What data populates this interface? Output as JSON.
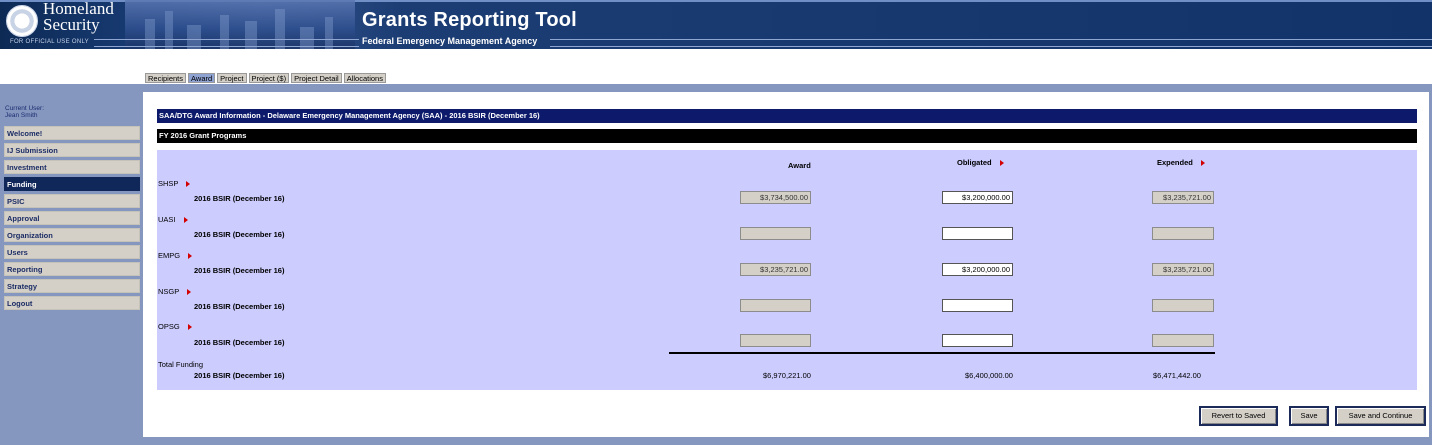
{
  "header": {
    "logo_text_line1": "Homeland",
    "logo_text_line2": "Security",
    "official_use": "FOR OFFICIAL USE ONLY",
    "title": "Grants Reporting Tool",
    "subtitle": "Federal Emergency Management Agency"
  },
  "tabs": [
    "Recipients",
    "Award",
    "Project",
    "Project ($)",
    "Project Detail",
    "Allocations"
  ],
  "active_tab": "Award",
  "user": {
    "label": "Current User:",
    "name": "Jean Smith"
  },
  "nav": [
    "Welcome!",
    "IJ Submission",
    "Investment",
    "Funding",
    "PSIC",
    "Approval",
    "Organization",
    "Users",
    "Reporting",
    "Strategy",
    "Logout"
  ],
  "active_nav": "Funding",
  "main": {
    "header_bar": "SAA/DTG Award Information - Delaware Emergency Management Agency (SAA) - 2016 BSIR (December 16)",
    "section_bar": "FY 2016 Grant Programs",
    "columns": {
      "award": "Award",
      "obligated": "Obligated",
      "expended": "Expended"
    },
    "programs": [
      {
        "name": "SHSP",
        "row_label": "2016 BSIR (December 16)",
        "award": "$3,734,500.00",
        "obligated": "$3,200,000.00",
        "expended": "$3,235,721.00"
      },
      {
        "name": "UASI",
        "row_label": "2016 BSIR (December 16)",
        "award": "",
        "obligated": "",
        "expended": ""
      },
      {
        "name": "EMPG",
        "row_label": "2016 BSIR (December 16)",
        "award": "$3,235,721.00",
        "obligated": "$3,200,000.00",
        "expended": "$3,235,721.00"
      },
      {
        "name": "NSGP",
        "row_label": "2016 BSIR (December 16)",
        "award": "",
        "obligated": "",
        "expended": ""
      },
      {
        "name": "OPSG",
        "row_label": "2016 BSIR (December 16)",
        "award": "",
        "obligated": "",
        "expended": ""
      }
    ],
    "total": {
      "label": "Total Funding",
      "row_label": "2016 BSIR (December 16)",
      "award": "$6,970,221.00",
      "obligated": "$6,400,000.00",
      "expended": "$6,471,442.00"
    }
  },
  "buttons": {
    "revert": "Revert to Saved",
    "save": "Save",
    "save_continue": "Save and Continue"
  },
  "colors": {
    "header_bg": "#12336a",
    "nav_active": "#10275a",
    "panel_bg": "#ccccff",
    "title_bar": "#0d1a6b",
    "arrow": "#d40000"
  }
}
